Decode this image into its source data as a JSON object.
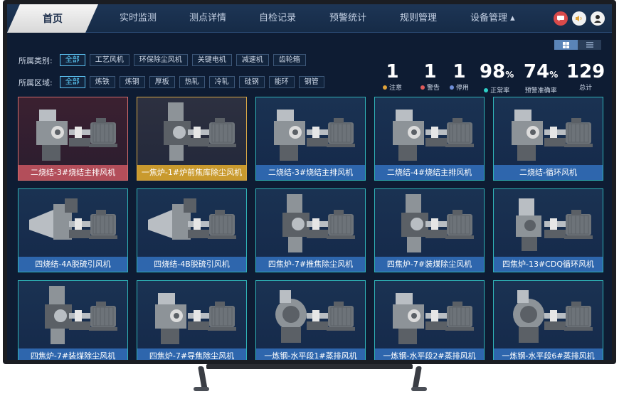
{
  "nav": {
    "home": "首页",
    "items": [
      "实时监测",
      "测点详情",
      "自检记录",
      "预警统计",
      "规则管理",
      "设备管理 ▴"
    ],
    "icons": [
      "message-icon",
      "sound-icon",
      "user-avatar-icon"
    ]
  },
  "filters": {
    "category_label": "所属类别:",
    "categories": [
      "全部",
      "工艺风机",
      "环保除尘风机",
      "关键电机",
      "减速机",
      "齿轮箱"
    ],
    "area_label": "所属区域:",
    "areas": [
      "全部",
      "炼铁",
      "炼钢",
      "厚板",
      "热轧",
      "冷轧",
      "硅钢",
      "能环",
      "钢管"
    ]
  },
  "stats": [
    {
      "value": "1",
      "suffix": "",
      "label": "注意",
      "color": "#e0a33a"
    },
    {
      "value": "1",
      "suffix": "",
      "label": "警告",
      "color": "#e05b5b"
    },
    {
      "value": "1",
      "suffix": "",
      "label": "停用",
      "color": "#6f8fd8"
    },
    {
      "value": "98",
      "suffix": "%",
      "label": "正常率",
      "color": "#2ed0c8"
    },
    {
      "value": "74",
      "suffix": "%",
      "label": "预警准确率",
      "color": ""
    },
    {
      "value": "129",
      "suffix": "",
      "label": "总计",
      "color": ""
    }
  ],
  "devices": [
    {
      "name": "二烧结-3#烧结主排风机",
      "status": "alarm",
      "type": "fan-a"
    },
    {
      "name": "一焦炉-1#炉前焦库除尘风机",
      "status": "warn",
      "type": "fan-tall"
    },
    {
      "name": "二烧结-3#烧结主排风机",
      "status": "normal",
      "type": "fan-a"
    },
    {
      "name": "二烧结-4#烧结主排风机",
      "status": "normal",
      "type": "fan-a"
    },
    {
      "name": "二烧结-循环风机",
      "status": "normal",
      "type": "fan-a"
    },
    {
      "name": "四烧结-4A脱硫引风机",
      "status": "normal",
      "type": "fan-cone"
    },
    {
      "name": "四烧结-4B脱硫引风机",
      "status": "normal",
      "type": "fan-cone"
    },
    {
      "name": "四焦炉-7#推焦除尘风机",
      "status": "normal",
      "type": "fan-tall"
    },
    {
      "name": "四焦炉-7#装煤除尘风机",
      "status": "normal",
      "type": "fan-tall"
    },
    {
      "name": "四焦炉-13#CDQ循环风机",
      "status": "normal",
      "type": "fan-b"
    },
    {
      "name": "四焦炉-7#装煤除尘风机",
      "status": "normal",
      "type": "fan-tall"
    },
    {
      "name": "四焦炉-7#导焦除尘风机",
      "status": "normal",
      "type": "fan-a"
    },
    {
      "name": "一炼钢-水平段1#蒸排风机",
      "status": "normal",
      "type": "fan-round"
    },
    {
      "name": "一炼钢-水平段2#蒸排风机",
      "status": "normal",
      "type": "fan-a"
    },
    {
      "name": "一炼钢-水平段6#蒸排风机",
      "status": "normal",
      "type": "fan-round"
    }
  ],
  "view_toggle": {
    "grid": "grid-view-icon",
    "list": "list-view-icon"
  }
}
